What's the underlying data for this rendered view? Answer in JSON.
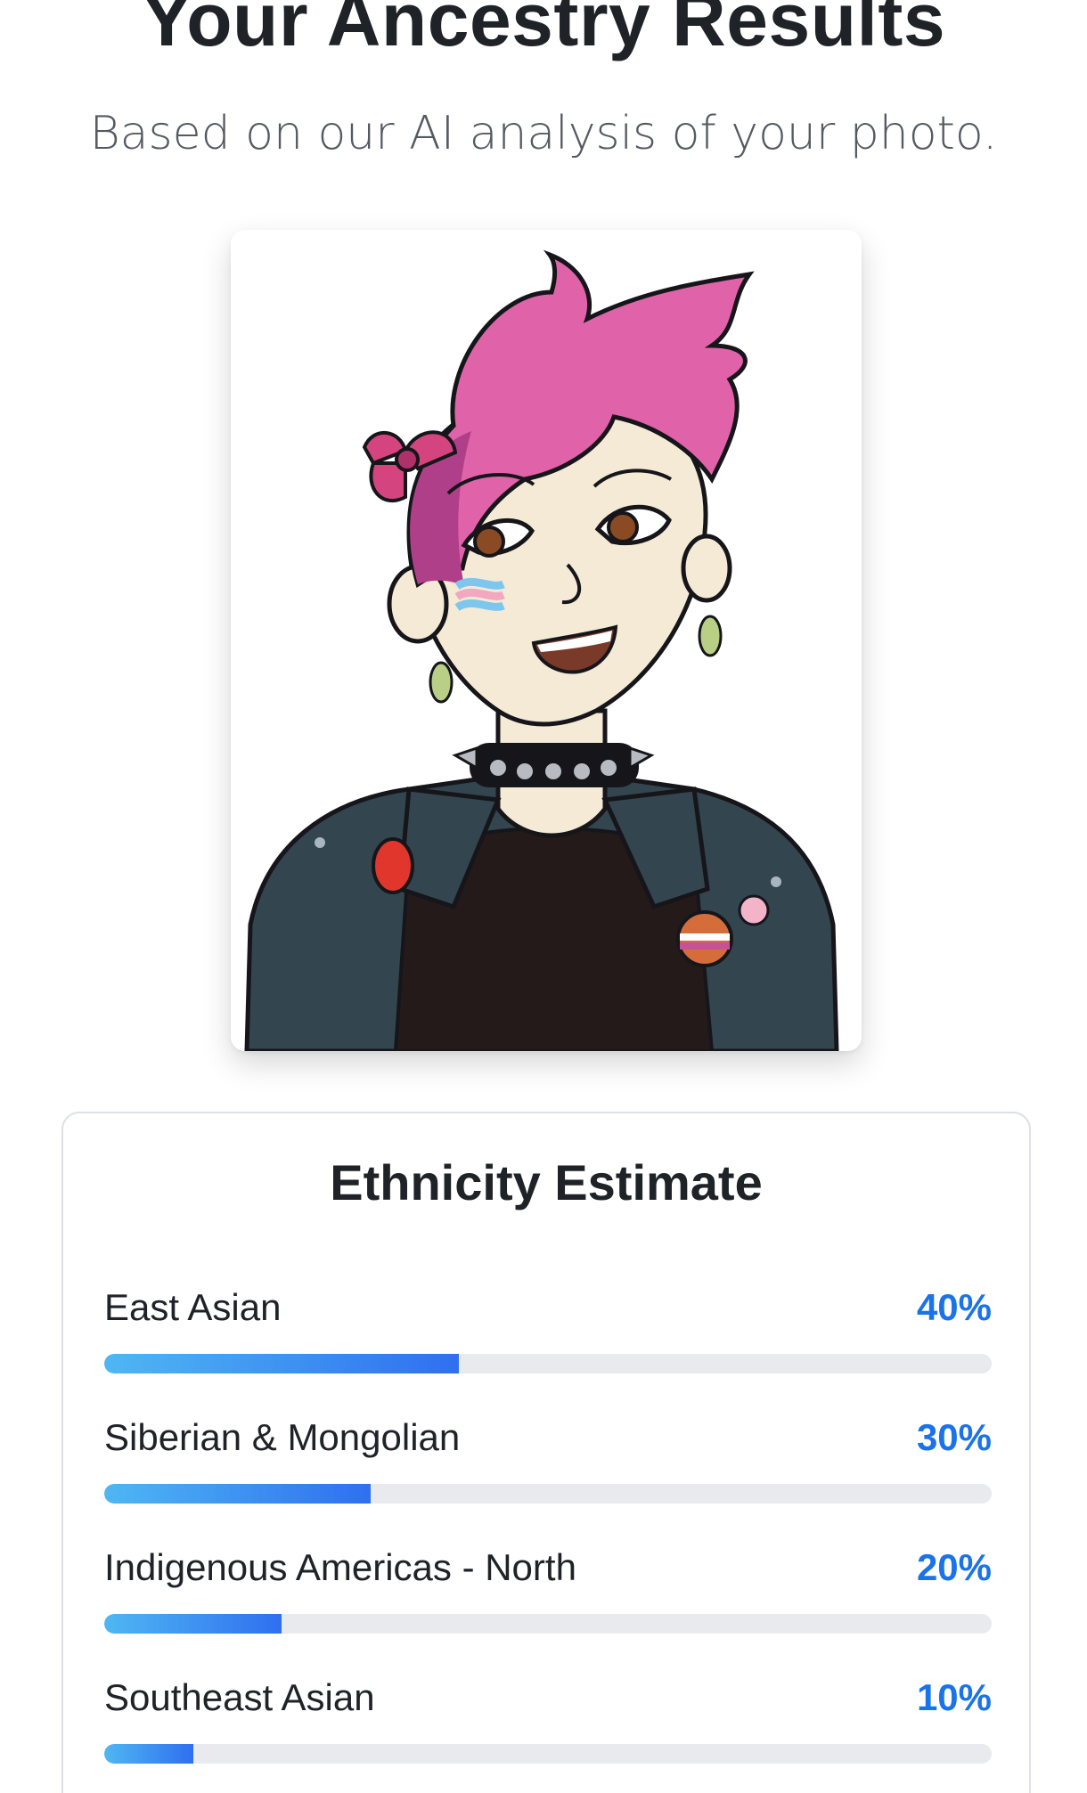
{
  "header": {
    "title": "Your Ancestry Results",
    "subtitle": "Based on our AI analysis of your photo."
  },
  "photo": {
    "icon": "uploaded-portrait-illustration"
  },
  "estimate": {
    "title": "Ethnicity Estimate",
    "accent_color": "#1a73e8",
    "bar_gradient": [
      "#4fb7f2",
      "#2f6ff0"
    ],
    "track_color": "#e8eaed",
    "items": [
      {
        "label": "East Asian",
        "value": "40%",
        "fraction": 0.4
      },
      {
        "label": "Siberian & Mongolian",
        "value": "30%",
        "fraction": 0.3
      },
      {
        "label": "Indigenous Americas - North",
        "value": "20%",
        "fraction": 0.2
      },
      {
        "label": "Southeast Asian",
        "value": "10%",
        "fraction": 0.1
      }
    ]
  }
}
